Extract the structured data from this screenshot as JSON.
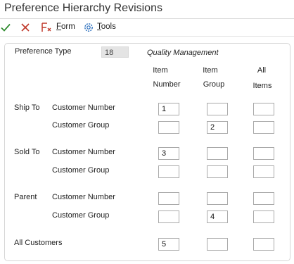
{
  "window": {
    "title": "Preference Hierarchy Revisions"
  },
  "toolbar": {
    "ok_icon": "checkmark-icon",
    "cancel_icon": "x-icon",
    "form_label": "Form",
    "form_accel": "F",
    "form_rest": "orm",
    "tools_label": "Tools",
    "tools_accel": "T",
    "tools_rest": "ools"
  },
  "form": {
    "preference_type_label": "Preference Type",
    "preference_type_value": "18",
    "preference_type_desc": "Quality Management",
    "col_item_number_1": "Item",
    "col_item_number_2": "Number",
    "col_item_group_1": "Item",
    "col_item_group_2": "Group",
    "col_all_items_1": "All",
    "col_all_items_2": "Items",
    "group_ship_to": "Ship To",
    "group_sold_to": "Sold To",
    "group_parent": "Parent",
    "customer_number_label": "Customer Number",
    "customer_group_label": "Customer Group",
    "all_customers_label": "All Customers"
  },
  "grid": {
    "ship_to_customer_number": [
      "1",
      "",
      ""
    ],
    "ship_to_customer_group": [
      "",
      "2",
      ""
    ],
    "sold_to_customer_number": [
      "3",
      "",
      ""
    ],
    "sold_to_customer_group": [
      "",
      "",
      ""
    ],
    "parent_customer_number": [
      "",
      "",
      ""
    ],
    "parent_customer_group": [
      "",
      "4",
      ""
    ],
    "all_customers": [
      "5",
      "",
      ""
    ]
  },
  "colors": {
    "ok_green": "#2e8b2e",
    "cancel_red": "#c0392b",
    "tools_blue": "#2a6ebd"
  }
}
